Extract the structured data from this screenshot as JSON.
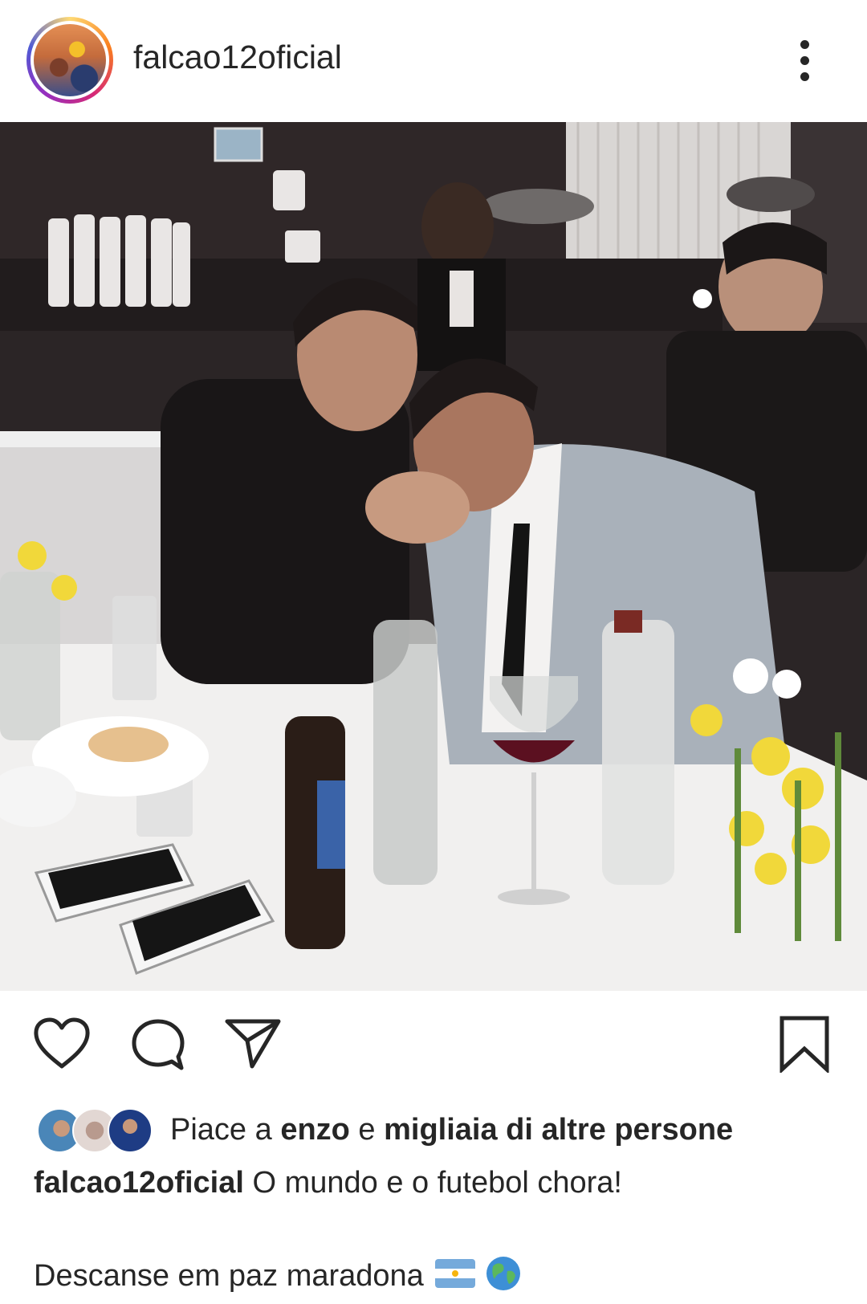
{
  "post": {
    "username": "falcao12oficial",
    "menu_icon": "more-vertical-icon"
  },
  "actions": {
    "like_icon": "heart-icon",
    "comment_icon": "comment-icon",
    "share_icon": "send-icon",
    "save_icon": "bookmark-icon"
  },
  "likes": {
    "prefix": "Piace a ",
    "user": "enzo",
    "middle": " e ",
    "others": "migliaia di altre persone"
  },
  "caption": {
    "username": "falcao12oficial",
    "text": " O mundo e o futebol chora!",
    "line2": "Descanse em paz maradona"
  },
  "colors": {
    "text": "#262626",
    "background": "#ffffff"
  }
}
